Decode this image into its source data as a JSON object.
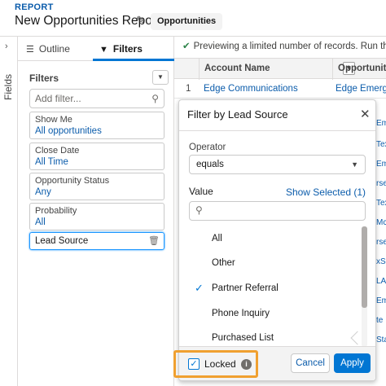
{
  "header": {
    "eyebrow": "REPORT",
    "title": "New Opportunities Report",
    "report_type": "Opportunities"
  },
  "rail": {
    "label": "Fields"
  },
  "panel": {
    "tabs": [
      {
        "label": "Outline",
        "icon": "list-icon"
      },
      {
        "label": "Filters",
        "icon": "filter-icon",
        "active": true
      }
    ],
    "heading": "Filters",
    "add_filter_placeholder": "Add filter...",
    "filters": [
      {
        "key": "Show Me",
        "value": "All opportunities"
      },
      {
        "key": "Close Date",
        "value": "All Time"
      },
      {
        "key": "Opportunity Status",
        "value": "Any"
      },
      {
        "key": "Probability",
        "value": "All"
      }
    ],
    "selected_filter": "Lead Source"
  },
  "table": {
    "banner": "Previewing a limited number of records. Run the report",
    "columns": [
      "Account Name",
      "Opportunity"
    ],
    "rows": [
      {
        "num": "1",
        "account": "Edge Communications",
        "opportunity": "Edge Emerge"
      }
    ],
    "right_fragments": [
      "Emer",
      "Tex",
      "Emer",
      "rse",
      "Tex",
      "Mc",
      "rse",
      "xS",
      "LA",
      "Emer",
      "te",
      "Sta"
    ]
  },
  "popover": {
    "title": "Filter by Lead Source",
    "operator_label": "Operator",
    "operator_value": "equals",
    "value_label": "Value",
    "show_selected": "Show Selected (1)",
    "search_placeholder": "",
    "options": [
      {
        "label": "All",
        "checked": false
      },
      {
        "label": "Other",
        "checked": false
      },
      {
        "label": "Partner Referral",
        "checked": true
      },
      {
        "label": "Phone Inquiry",
        "checked": false
      },
      {
        "label": "Purchased List",
        "checked": false
      }
    ],
    "locked_label": "Locked",
    "locked_checked": true,
    "cancel_label": "Cancel",
    "apply_label": "Apply"
  },
  "colors": {
    "brand_blue": "#0176d3",
    "link_blue": "#0b5cab",
    "highlight_orange": "#f0a030",
    "success_green": "#2e844a"
  }
}
